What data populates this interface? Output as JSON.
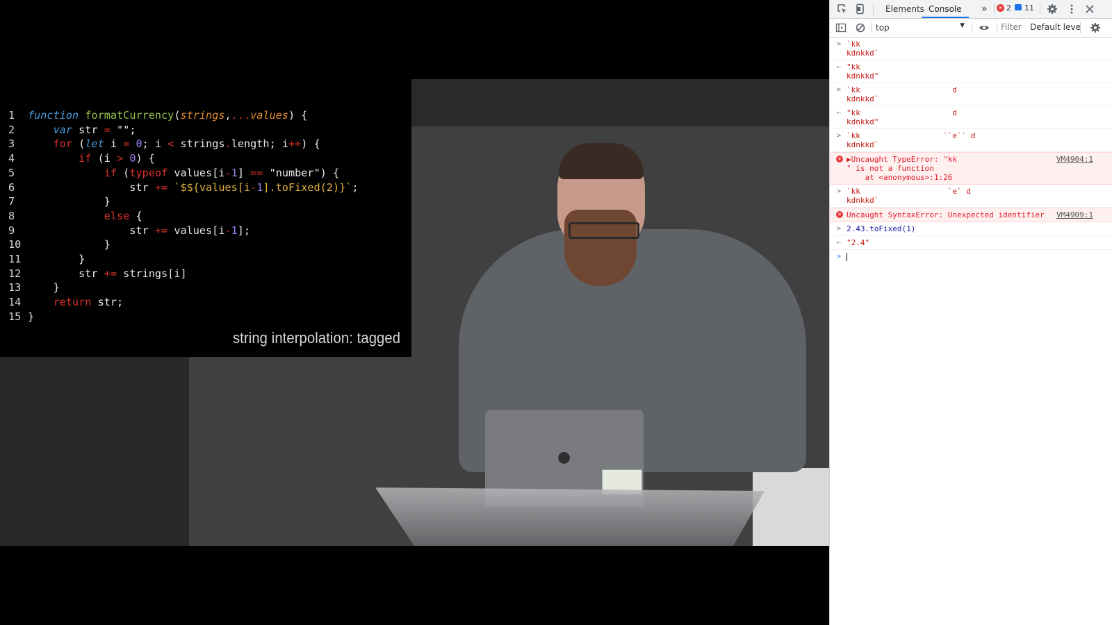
{
  "slide": {
    "lines": [
      {
        "n": "1"
      },
      {
        "n": "2"
      },
      {
        "n": "3"
      },
      {
        "n": "4"
      },
      {
        "n": "5"
      },
      {
        "n": "6"
      },
      {
        "n": "7"
      },
      {
        "n": "8"
      },
      {
        "n": "9"
      },
      {
        "n": "10"
      },
      {
        "n": "11"
      },
      {
        "n": "12"
      },
      {
        "n": "13"
      },
      {
        "n": "14"
      },
      {
        "n": "15"
      }
    ],
    "caption": "string interpolation: tagged"
  },
  "devtools": {
    "tabs": [
      "Elements",
      "Console"
    ],
    "active_tab": "Console",
    "more_tabs": "»",
    "error_count": "2",
    "message_count": "11",
    "context": "top",
    "filter_placeholder": "Filter",
    "level": "Default leve",
    "entries": [
      {
        "kind": "input",
        "text": "`kk\nkdnkkd`"
      },
      {
        "kind": "result",
        "text": "\"kk\nkdnkkd\""
      },
      {
        "kind": "input",
        "text": "`kk                    d\nkdnkkd`"
      },
      {
        "kind": "result",
        "text": "\"kk                    d\nkdnkkd\""
      },
      {
        "kind": "input",
        "text": "`kk                  ``e`` d\nkdnkkd`"
      },
      {
        "kind": "error",
        "text": "▶Uncaught TypeError: \"kk\n\" is not a function\n    at <anonymous>:1:26",
        "source": "VM4904:1"
      },
      {
        "kind": "input",
        "text": "`kk                   `e` d\nkdnkkd`"
      },
      {
        "kind": "error",
        "text": "Uncaught SyntaxError: Unexpected identifier",
        "source": "VM4909:1"
      },
      {
        "kind": "input",
        "text": "2.43.toFixed(1)"
      },
      {
        "kind": "result",
        "text": "\"2.4\""
      }
    ],
    "prompt_value": ""
  },
  "colors": {
    "accent": "#1a73e8",
    "error": "#e43a3a",
    "error_bg": "#fff0f0"
  }
}
